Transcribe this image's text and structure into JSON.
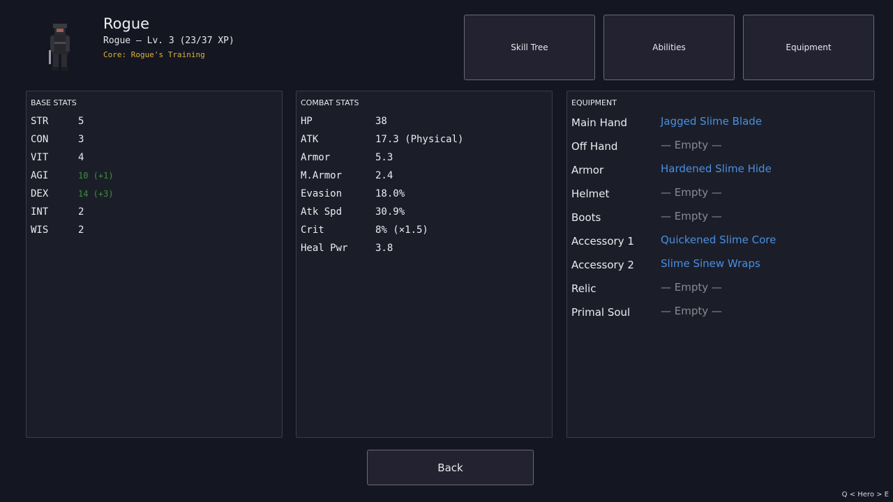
{
  "hero": {
    "name": "Rogue",
    "subtitle": "Rogue — Lv. 3 (23/37 XP)",
    "core": "Core: Rogue's Training"
  },
  "nav": {
    "skill_tree": "Skill Tree",
    "abilities": "Abilities",
    "equipment": "Equipment"
  },
  "base_stats": {
    "title": "BASE STATS",
    "rows": [
      {
        "label": "STR",
        "value": "5"
      },
      {
        "label": "CON",
        "value": "3"
      },
      {
        "label": "VIT",
        "value": "4"
      },
      {
        "label": "AGI",
        "value": "10 (+1)"
      },
      {
        "label": "DEX",
        "value": "14 (+3)"
      },
      {
        "label": "INT",
        "value": "2"
      },
      {
        "label": "WIS",
        "value": "2"
      }
    ]
  },
  "combat_stats": {
    "title": "COMBAT STATS",
    "rows": [
      {
        "label": "HP",
        "value": "38"
      },
      {
        "label": "ATK",
        "value": "17.3 (Physical)"
      },
      {
        "label": "Armor",
        "value": "5.3"
      },
      {
        "label": "M.Armor",
        "value": "2.4"
      },
      {
        "label": "Evasion",
        "value": "18.0%"
      },
      {
        "label": "Atk Spd",
        "value": "30.9%"
      },
      {
        "label": "Crit",
        "value": "8% (×1.5)"
      },
      {
        "label": "Heal Pwr",
        "value": "3.8"
      }
    ]
  },
  "equipment": {
    "title": "EQUIPMENT",
    "slots": [
      {
        "slot": "Main Hand",
        "item": "Jagged Slime Blade"
      },
      {
        "slot": "Off Hand",
        "item": "— Empty —"
      },
      {
        "slot": "Armor",
        "item": "Hardened Slime Hide"
      },
      {
        "slot": "Helmet",
        "item": "— Empty —"
      },
      {
        "slot": "Boots",
        "item": "— Empty —"
      },
      {
        "slot": "Accessory 1",
        "item": "Quickened Slime Core"
      },
      {
        "slot": "Accessory 2",
        "item": "Slime Sinew Wraps"
      },
      {
        "slot": "Relic",
        "item": "— Empty —"
      },
      {
        "slot": "Primal Soul",
        "item": "— Empty —"
      }
    ]
  },
  "back_label": "Back",
  "footer_hint": "Q < Hero > E",
  "colors": {
    "background": "#141722",
    "panel": "#1b1e29",
    "item_link": "#4a8fe0",
    "empty_slot": "#8a8a92",
    "stat_bonus": "#3f8f3a",
    "core_text": "#e0b23a"
  }
}
